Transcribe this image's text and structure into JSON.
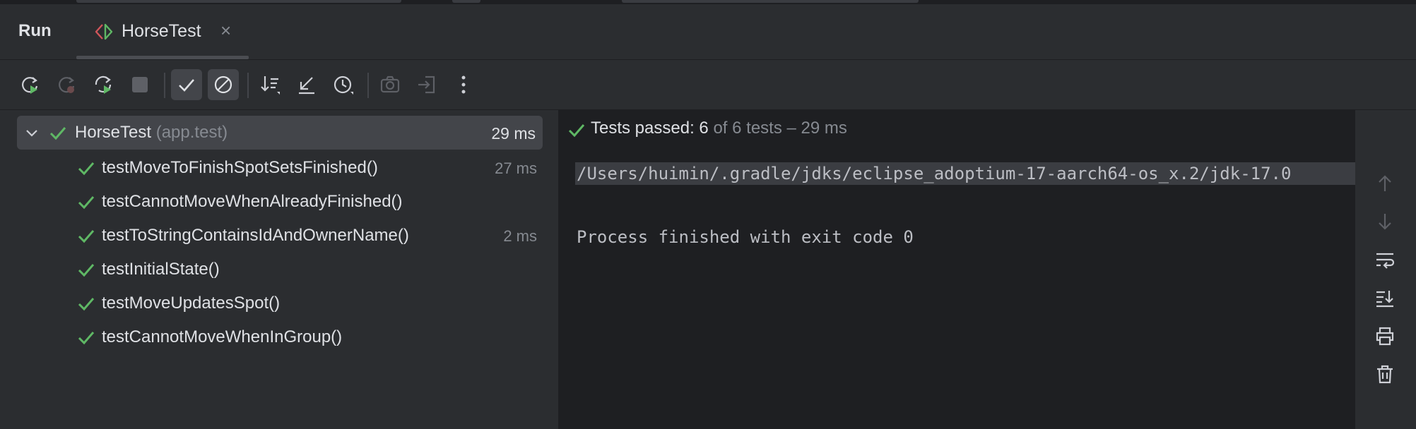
{
  "panel": {
    "title": "Run"
  },
  "tab": {
    "title": "HorseTest",
    "close_glyph": "×",
    "icon": "run-config-icon"
  },
  "toolbar": {
    "buttons": [
      {
        "name": "rerun-icon",
        "enabled": true
      },
      {
        "name": "rerun-failed-icon",
        "enabled": false
      },
      {
        "name": "toggle-auto-test-icon",
        "enabled": true
      },
      {
        "name": "stop-icon",
        "enabled": false
      },
      {
        "name": "show-passed-icon",
        "active": true
      },
      {
        "name": "show-ignored-icon",
        "active": true
      },
      {
        "name": "sort-icon",
        "enabled": true
      },
      {
        "name": "collapse-icon",
        "enabled": true
      },
      {
        "name": "history-icon",
        "enabled": true
      },
      {
        "name": "camera-icon",
        "enabled": false
      },
      {
        "name": "import-icon",
        "enabled": false
      },
      {
        "name": "more-icon",
        "enabled": true
      }
    ]
  },
  "tree": {
    "root": {
      "name": "HorseTest",
      "qualifier": "(app.test)",
      "duration": "29 ms"
    },
    "tests": [
      {
        "name": "testMoveToFinishSpotSetsFinished()",
        "duration": "27 ms"
      },
      {
        "name": "testCannotMoveWhenAlreadyFinished()",
        "duration": ""
      },
      {
        "name": "testToStringContainsIdAndOwnerName()",
        "duration": "2 ms"
      },
      {
        "name": "testInitialState()",
        "duration": ""
      },
      {
        "name": "testMoveUpdatesSpot()",
        "duration": ""
      },
      {
        "name": "testCannotMoveWhenInGroup()",
        "duration": ""
      }
    ]
  },
  "console": {
    "status_label": "Tests passed: ",
    "status_count": "6",
    "status_rest": " of 6 tests – 29 ms",
    "line1": "/Users/huimin/.gradle/jdks/eclipse_adoptium-17-aarch64-os_x.2/jdk-17.0",
    "line2": "Process finished with exit code 0"
  },
  "colors": {
    "pass_green": "#5fb865",
    "background": "#1e1f22",
    "panel": "#2b2d30"
  }
}
